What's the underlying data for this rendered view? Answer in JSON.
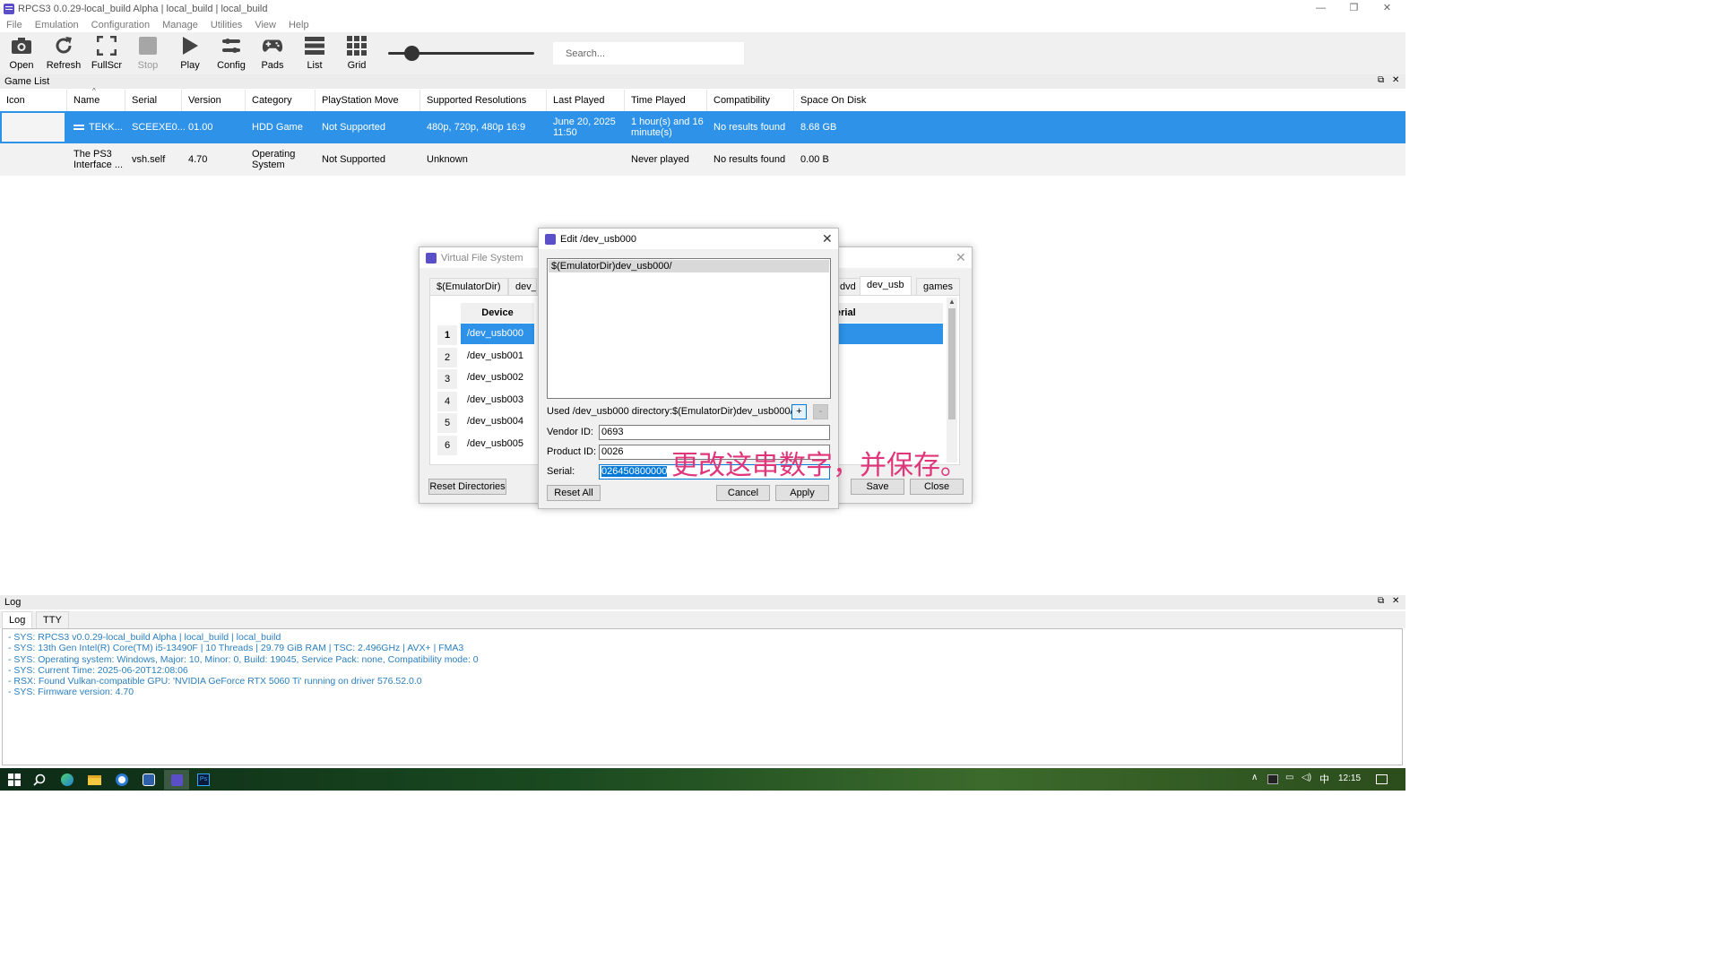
{
  "window": {
    "title": "RPCS3 0.0.29-local_build Alpha | local_build | local_build",
    "minimize": "—",
    "restore": "❐",
    "close": "✕"
  },
  "menu": [
    "File",
    "Emulation",
    "Configuration",
    "Manage",
    "Utilities",
    "View",
    "Help"
  ],
  "toolbar": {
    "buttons": [
      {
        "label": "Open",
        "icon": "camera-icon"
      },
      {
        "label": "Refresh",
        "icon": "refresh-icon"
      },
      {
        "label": "FullScr",
        "icon": "fullscreen-icon"
      },
      {
        "label": "Stop",
        "icon": "stop-icon"
      },
      {
        "label": "Play",
        "icon": "play-icon"
      },
      {
        "label": "Config",
        "icon": "config-icon"
      },
      {
        "label": "Pads",
        "icon": "gamepad-icon"
      },
      {
        "label": "List",
        "icon": "list-icon"
      },
      {
        "label": "Grid",
        "icon": "grid-icon"
      }
    ],
    "search_placeholder": "Search..."
  },
  "game_list": {
    "title": "Game List",
    "columns": [
      "Icon",
      "Name",
      "Serial",
      "Version",
      "Category",
      "PlayStation Move",
      "Supported Resolutions",
      "Last Played",
      "Time Played",
      "Compatibility",
      "Space On Disk"
    ],
    "rows": [
      {
        "name": "TEKK...",
        "serial": "SCEEXE0...",
        "version": "01.00",
        "category": "HDD Game",
        "move": "Not Supported",
        "resolutions": "480p, 720p, 480p 16:9",
        "last_played": "June 20, 2025 11:50",
        "time_played": "1 hour(s) and 16 minute(s)",
        "compat": "No results found",
        "space": "8.68 GB",
        "selected": true
      },
      {
        "name": "The PS3 Interface ...",
        "serial": "vsh.self",
        "version": "4.70",
        "category": "Operating System",
        "move": "Not Supported",
        "resolutions": "Unknown",
        "last_played": "",
        "time_played": "Never played",
        "compat": "No results found",
        "space": "0.00 B",
        "selected": false
      }
    ]
  },
  "vfs": {
    "title": "Virtual File System",
    "tabs": [
      "$(EmulatorDir)",
      "dev_h",
      "dvd",
      "dev_usb",
      "games"
    ],
    "active_tab": "dev_usb",
    "device_header": "Device",
    "serial_header": "erial",
    "rows": [
      {
        "n": "1",
        "device": "/dev_usb000"
      },
      {
        "n": "2",
        "device": "/dev_usb001"
      },
      {
        "n": "3",
        "device": "/dev_usb002"
      },
      {
        "n": "4",
        "device": "/dev_usb003"
      },
      {
        "n": "5",
        "device": "/dev_usb004"
      },
      {
        "n": "6",
        "device": "/dev_usb005"
      }
    ],
    "reset_label": "Reset Directories",
    "save_label": "Save",
    "close_label": "Close"
  },
  "edit": {
    "title": "Edit /dev_usb000",
    "path_item": "$(EmulatorDir)dev_usb000/",
    "used_label": "Used /dev_usb000 directory:",
    "used_value": "$(EmulatorDir)dev_usb000/",
    "add_label": "+",
    "remove_label": "-",
    "vendor_label": "Vendor ID:",
    "vendor_value": "0693",
    "product_label": "Product ID:",
    "product_value": "0026",
    "serial_label": "Serial:",
    "serial_value": "026450800000",
    "reset_all": "Reset All",
    "cancel": "Cancel",
    "apply": "Apply"
  },
  "annotation": "更改这串数字，并保存。",
  "log": {
    "title": "Log",
    "tabs": [
      "Log",
      "TTY"
    ],
    "lines": [
      "- SYS: RPCS3 v0.0.29-local_build Alpha | local_build | local_build",
      "- SYS: 13th Gen Intel(R) Core(TM) i5-13490F | 10 Threads | 29.79 GiB RAM | TSC: 2.496GHz | AVX+ | FMA3",
      "- SYS: Operating system: Windows, Major: 10, Minor: 0, Build: 19045, Service Pack: none, Compatibility mode: 0",
      "- SYS: Current Time: 2025-06-20T12:08:06",
      "- RSX: Found Vulkan-compatible GPU: 'NVIDIA GeForce RTX 5060 Ti' running on driver 576.52.0.0",
      "- SYS: Firmware version: 4.70"
    ]
  },
  "taskbar": {
    "ime": "中",
    "time": "12:15"
  }
}
